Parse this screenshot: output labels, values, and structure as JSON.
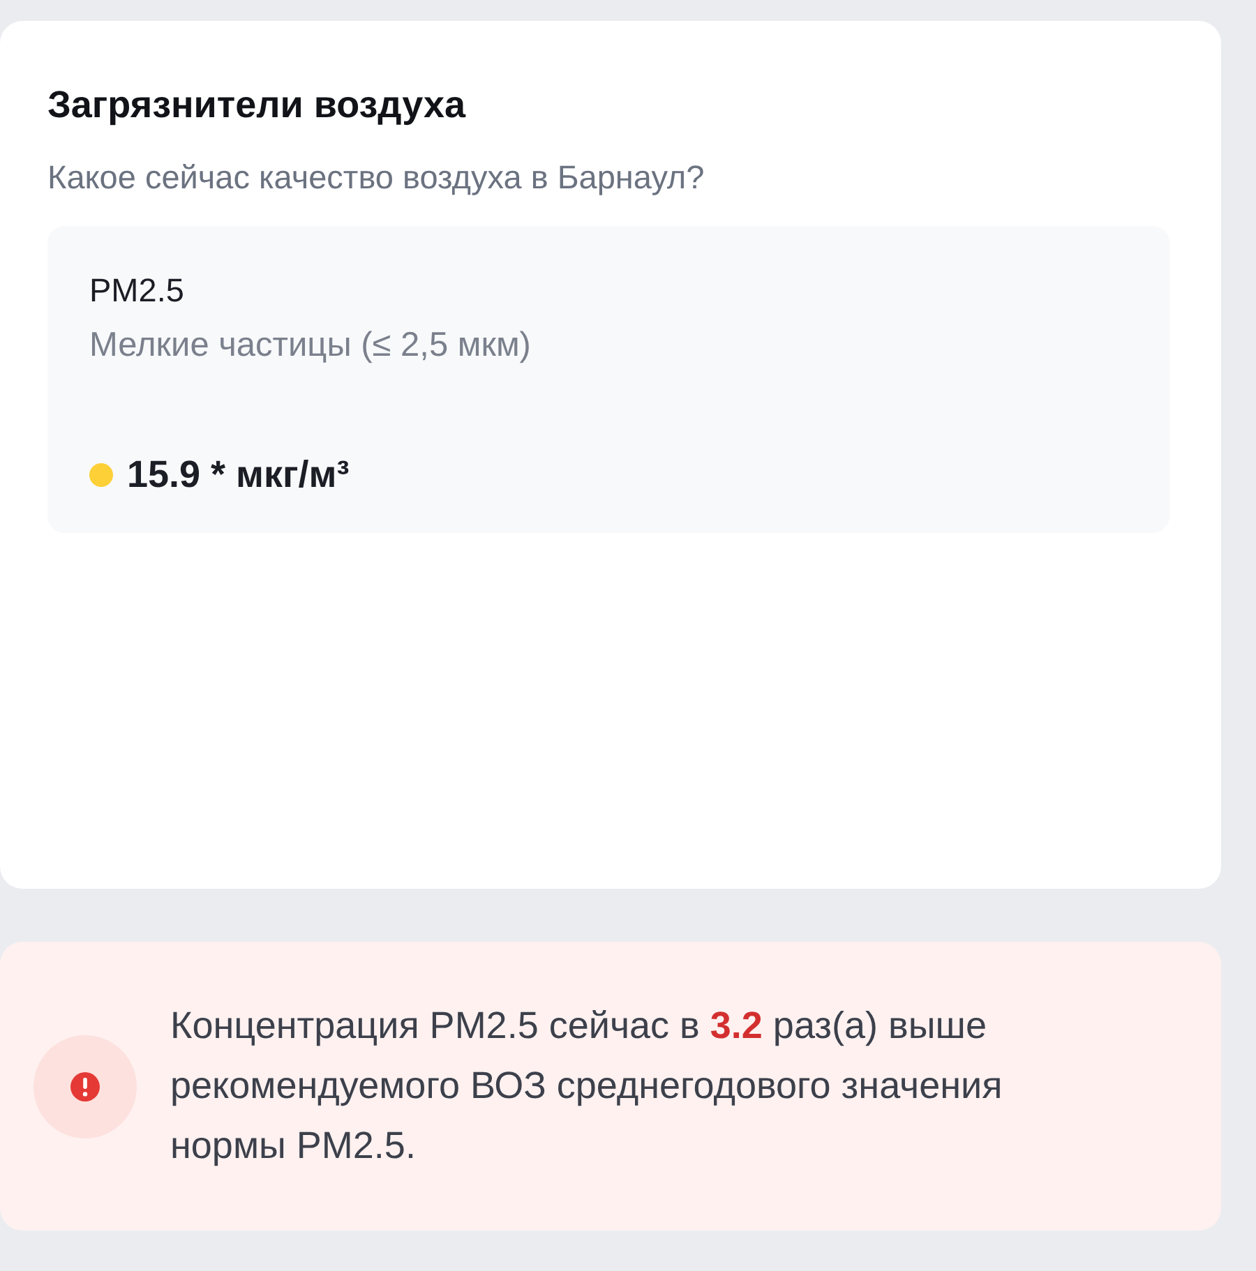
{
  "card": {
    "title": "Загрязнители воздуха",
    "subtitle": "Какое сейчас качество воздуха в Барнаул?",
    "pollutants": [
      {
        "name": "PM2.5",
        "description": "Мелкие частицы (≤ 2,5 мкм)",
        "value": "15.9 * мкг/м³",
        "color": "#fcd036"
      }
    ]
  },
  "alert": {
    "kind": "danger",
    "text": "Концентрация PM2.5 сейчас в **3.2** раз(а) выше рекомендуемого ВОЗ среднегодового значения нормы PM2.5."
  }
}
